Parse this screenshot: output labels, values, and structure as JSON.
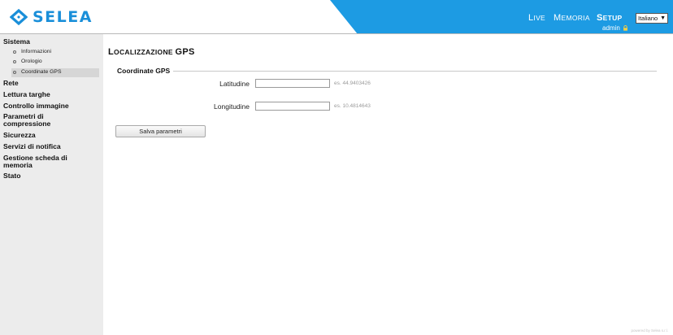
{
  "header": {
    "logo_text": "SELEA",
    "logo_icon": "selea-diamond-logo",
    "nav": {
      "live": {
        "first": "L",
        "rest": "IVE"
      },
      "memoria": {
        "first": "M",
        "rest": "EMORIA"
      },
      "setup": {
        "first": "S",
        "rest": "ETUP"
      }
    },
    "language": "Italiano",
    "user": "admin",
    "lock_icon": "lock-icon",
    "accent_color": "#1d9be3",
    "logo_color": "#1a8fd9"
  },
  "sidebar": {
    "sistema": "Sistema",
    "sub_items": [
      "Informazioni",
      "Orologio",
      "Coordinate GPS"
    ],
    "active_sub": "Coordinate GPS",
    "items": [
      "Rete",
      "Lettura targhe",
      "Controllo immagine",
      "Parametri di compressione",
      "Sicurezza",
      "Servizi di notifica",
      "Gestione scheda di memoria",
      "Stato"
    ]
  },
  "main": {
    "title": {
      "first": "L",
      "rest": "OCALIZZAZIONE ",
      "suffix": "GPS"
    },
    "legend": "Coordinate GPS",
    "latitude_label": "Latitudine",
    "latitude_value": "",
    "latitude_hint": "es. 44.9403426",
    "longitude_label": "Longitudine",
    "longitude_value": "",
    "longitude_hint": "es. 10.4814643",
    "save_label": "Salva parametri"
  },
  "footer": "powered by Selea s.r.l."
}
